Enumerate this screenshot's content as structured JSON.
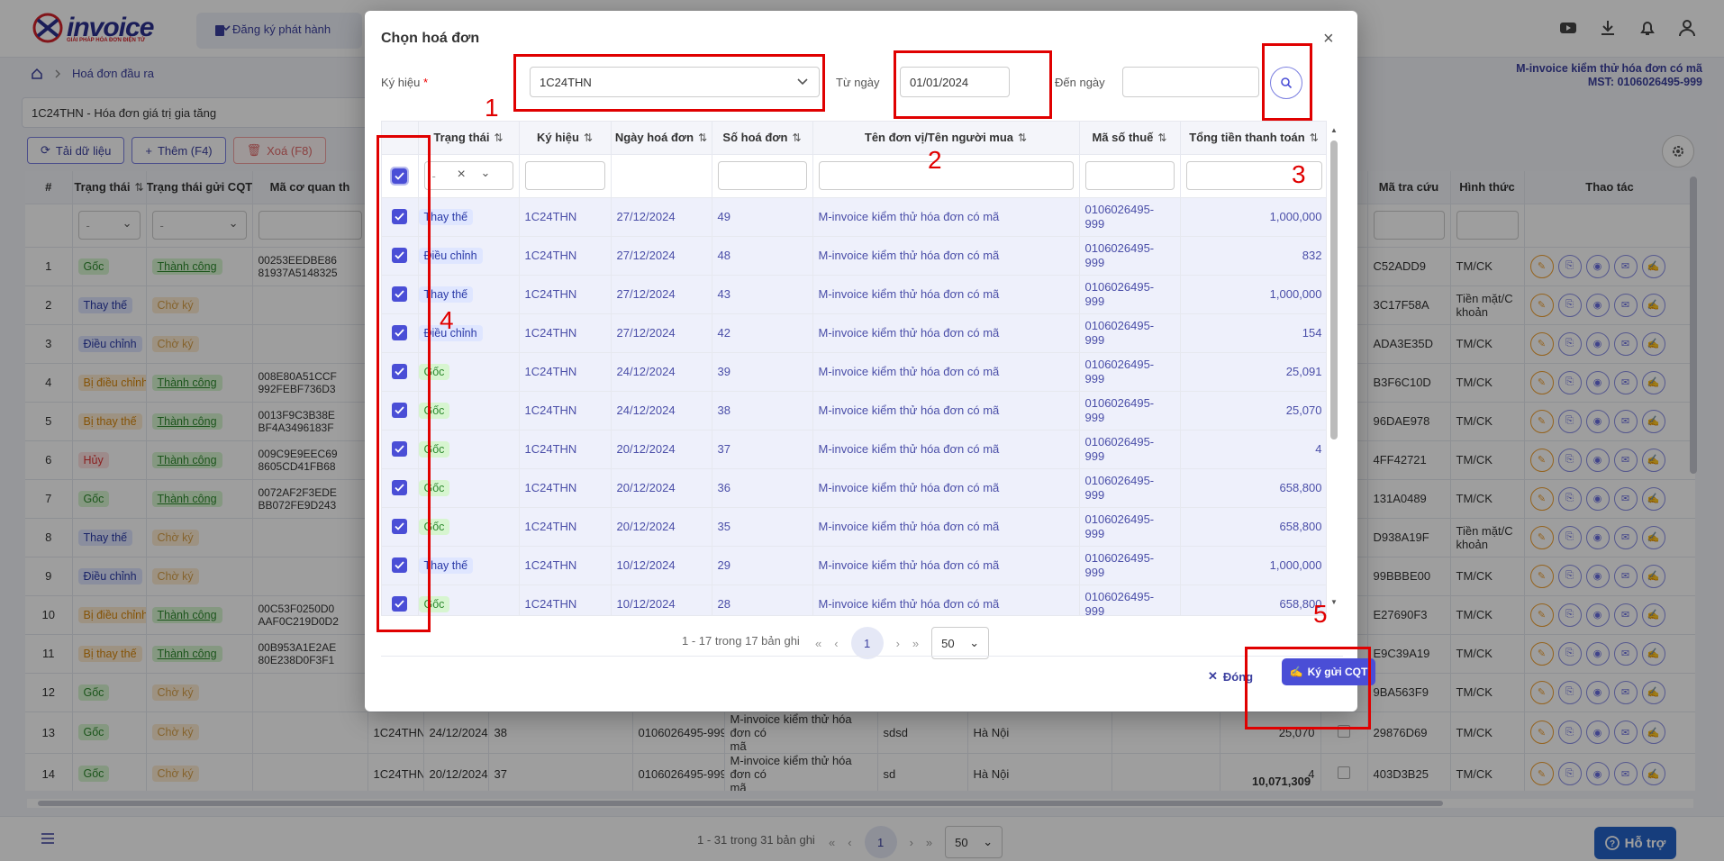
{
  "header": {
    "logo_text": "invoice",
    "logo_sub": "GIẢI PHÁP HÓA ĐƠN ĐIỆN TỬ",
    "menu_register": "Đăng ký phát hành",
    "icons": [
      "youtube-icon",
      "download-icon",
      "bell-icon",
      "user-icon"
    ]
  },
  "breadcrumb": {
    "home_icon": "home-icon",
    "item": "Hoá đơn đầu ra"
  },
  "company": {
    "name": "M-invoice kiểm thử hóa đơn có mã",
    "tax": "MST: 0106026495-999"
  },
  "serial_select": "1C24THN - Hóa đơn giá trị gia tăng",
  "toolbar": {
    "reload": "Tải dữ liệu",
    "add": "Thêm (F4)",
    "delete": "Xoá (F8)"
  },
  "main_table": {
    "headers": [
      "#",
      "Trạng thái",
      "Trạng thái gửi CQT",
      "Mã cơ quan th",
      "Mã tra cứu",
      "Hình thức",
      "Thao tác"
    ],
    "filter_placeholder": "-",
    "rows": [
      {
        "n": "1",
        "status": "Gốc",
        "st": "goc",
        "cqt": "Thành công",
        "cqtc": "tc",
        "ma": "00253EEDBE86\n81937A5148325",
        "code": "C52ADD9",
        "pay": "TM/CK"
      },
      {
        "n": "2",
        "status": "Thay thế",
        "st": "tt",
        "cqt": "Chờ ký",
        "cqtc": "ck",
        "ma": "",
        "code": "3C17F58A",
        "pay": "Tiền mặt/C\nkhoản"
      },
      {
        "n": "3",
        "status": "Điều chỉnh",
        "st": "dc",
        "cqt": "Chờ ký",
        "cqtc": "ck",
        "ma": "",
        "code": "ADA3E35D",
        "pay": "TM/CK"
      },
      {
        "n": "4",
        "status": "Bị điều chỉnh",
        "st": "bdc",
        "cqt": "Thành công",
        "cqtc": "tc",
        "ma": "008E80A51CCF\n992FEBF736D3",
        "code": "B3F6C10D",
        "pay": "TM/CK"
      },
      {
        "n": "5",
        "status": "Bị thay thế",
        "st": "bdc",
        "cqt": "Thành công",
        "cqtc": "tc",
        "ma": "0013F9C3B38E\nBF4A3496183F",
        "code": "96DAE978",
        "pay": "TM/CK"
      },
      {
        "n": "6",
        "status": "Hủy",
        "st": "huy",
        "cqt": "Thành công",
        "cqtc": "tc",
        "ma": "009C9E9EEC69\n8605CD41FB68",
        "code": "4FF42721",
        "pay": "TM/CK"
      },
      {
        "n": "7",
        "status": "Gốc",
        "st": "goc",
        "cqt": "Thành công",
        "cqtc": "tc",
        "ma": "0072AF2F3EDE\nBB072FE9D243",
        "code": "131A0489",
        "pay": "TM/CK"
      },
      {
        "n": "8",
        "status": "Thay thế",
        "st": "tt",
        "cqt": "Chờ ký",
        "cqtc": "ck",
        "ma": "",
        "code": "D938A19F",
        "pay": "Tiền mặt/C\nkhoản"
      },
      {
        "n": "9",
        "status": "Điều chỉnh",
        "st": "dc",
        "cqt": "Chờ ký",
        "cqtc": "ck",
        "ma": "",
        "code": "99BBBE00",
        "pay": "TM/CK"
      },
      {
        "n": "10",
        "status": "Bị điều chỉnh",
        "st": "bdc",
        "cqt": "Thành công",
        "cqtc": "tc",
        "ma": "00C53F0250D0\nAAF0C219D0D2",
        "code": "E27690F3",
        "pay": "TM/CK"
      },
      {
        "n": "11",
        "status": "Bị thay thế",
        "st": "bdc",
        "cqt": "Thành công",
        "cqtc": "tc",
        "ma": "00B953A1E2AE\n80E238D0F3F1",
        "code": "E9C39A19",
        "pay": "TM/CK"
      },
      {
        "n": "12",
        "status": "Gốc",
        "st": "goc",
        "cqt": "Chờ ký",
        "cqtc": "ck",
        "ma": "",
        "code": "9BA563F9",
        "pay": "TM/CK"
      },
      {
        "n": "13",
        "status": "Gốc",
        "st": "goc",
        "cqt": "Chờ ký",
        "cqtc": "ck",
        "ma": "",
        "code": "29876D69",
        "pay": "TM/CK"
      },
      {
        "n": "14",
        "status": "Gốc",
        "st": "goc",
        "cqt": "Chờ ký",
        "cqtc": "ck",
        "ma": "",
        "code": "403D3B25",
        "pay": "TM/CK"
      }
    ],
    "peek_rows": [
      {
        "serial": "1C24THN",
        "date": "24/12/2024",
        "no": "38",
        "mst": "0106026495-999",
        "name": "M-invoice kiểm thử hóa đơn có\nmã",
        "buyer": "sdsd",
        "addr": "Hà Nội",
        "total": "25,070"
      },
      {
        "serial": "1C24THN",
        "date": "20/12/2024",
        "no": "37",
        "mst": "0106026495-999",
        "name": "M-invoice kiểm thử hóa đơn có\nmã",
        "buyer": "sd",
        "addr": "Hà Nội",
        "total": "4"
      }
    ],
    "sum_total": "10,071,309"
  },
  "main_pager": {
    "info": "1 - 31 trong 31 bản ghi",
    "page": "1",
    "size": "50"
  },
  "help_button": "Hỗ trợ",
  "modal": {
    "title": "Chọn hoá đơn",
    "fields": {
      "serial_label": "Ký hiệu",
      "required": "*",
      "serial_value": "1C24THN",
      "from_label": "Từ ngày",
      "from_value": "01/01/2024",
      "to_label": "Đến ngày",
      "to_value": ""
    },
    "headers": [
      "Trạng thái",
      "Ký hiệu",
      "Ngày hoá đơn",
      "Số hoá đơn",
      "Tên đơn vị/Tên người mua",
      "Mã số thuế",
      "Tổng tiền thanh toán"
    ],
    "filter_status": "-",
    "rows": [
      {
        "status": "Thay thế",
        "st": "tt",
        "serial": "1C24THN",
        "date": "27/12/2024",
        "no": "49",
        "name": "M-invoice kiểm thử hóa đơn có mã",
        "mst": "0106026495-\n999",
        "total": "1,000,000"
      },
      {
        "status": "Điều chỉnh",
        "st": "dc",
        "serial": "1C24THN",
        "date": "27/12/2024",
        "no": "48",
        "name": "M-invoice kiểm thử hóa đơn có mã",
        "mst": "0106026495-\n999",
        "total": "832"
      },
      {
        "status": "Thay thế",
        "st": "tt",
        "serial": "1C24THN",
        "date": "27/12/2024",
        "no": "43",
        "name": "M-invoice kiểm thử hóa đơn có mã",
        "mst": "0106026495-\n999",
        "total": "1,000,000"
      },
      {
        "status": "Điều chỉnh",
        "st": "dc",
        "serial": "1C24THN",
        "date": "27/12/2024",
        "no": "42",
        "name": "M-invoice kiểm thử hóa đơn có mã",
        "mst": "0106026495-\n999",
        "total": "154"
      },
      {
        "status": "Gốc",
        "st": "goc",
        "serial": "1C24THN",
        "date": "24/12/2024",
        "no": "39",
        "name": "M-invoice kiểm thử hóa đơn có mã",
        "mst": "0106026495-\n999",
        "total": "25,091"
      },
      {
        "status": "Gốc",
        "st": "goc",
        "serial": "1C24THN",
        "date": "24/12/2024",
        "no": "38",
        "name": "M-invoice kiểm thử hóa đơn có mã",
        "mst": "0106026495-\n999",
        "total": "25,070"
      },
      {
        "status": "Gốc",
        "st": "goc",
        "serial": "1C24THN",
        "date": "20/12/2024",
        "no": "37",
        "name": "M-invoice kiểm thử hóa đơn có mã",
        "mst": "0106026495-\n999",
        "total": "4"
      },
      {
        "status": "Gốc",
        "st": "goc",
        "serial": "1C24THN",
        "date": "20/12/2024",
        "no": "36",
        "name": "M-invoice kiểm thử hóa đơn có mã",
        "mst": "0106026495-\n999",
        "total": "658,800"
      },
      {
        "status": "Gốc",
        "st": "goc",
        "serial": "1C24THN",
        "date": "20/12/2024",
        "no": "35",
        "name": "M-invoice kiểm thử hóa đơn có mã",
        "mst": "0106026495-\n999",
        "total": "658,800"
      },
      {
        "status": "Thay thế",
        "st": "tt",
        "serial": "1C24THN",
        "date": "10/12/2024",
        "no": "29",
        "name": "M-invoice kiểm thử hóa đơn có mã",
        "mst": "0106026495-\n999",
        "total": "1,000,000"
      },
      {
        "status": "Gốc",
        "st": "goc",
        "serial": "1C24THN",
        "date": "10/12/2024",
        "no": "28",
        "name": "M-invoice kiểm thử hóa đơn có mã",
        "mst": "0106026495-\n999",
        "total": "658,800"
      }
    ],
    "pager": {
      "info": "1 - 17 trong 17 bản ghi",
      "page": "1",
      "size": "50"
    },
    "close_label": "Đóng",
    "sign_label": "Ký gửi CQT"
  },
  "annotations": [
    "1",
    "2",
    "3",
    "4",
    "5"
  ],
  "colors": {
    "primary": "#4a4ed6",
    "annotation": "#e00000"
  }
}
